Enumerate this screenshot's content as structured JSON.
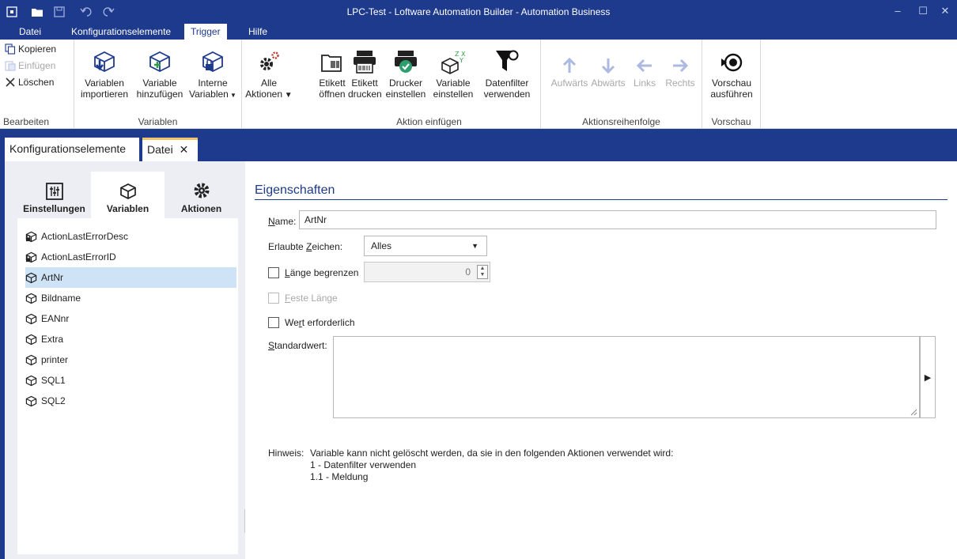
{
  "window": {
    "title": "LPC-Test - Loftware Automation Builder - Automation Business",
    "minimize": "–",
    "maximize": "☐",
    "close": "✕"
  },
  "menu": {
    "items": [
      "Datei",
      "Konfigurationselemente",
      "Trigger",
      "Hilfe"
    ],
    "active": "Trigger"
  },
  "ribbon": {
    "bearbeiten": {
      "label": "Bearbeiten",
      "kopieren": "Kopieren",
      "einfuegen": "Einfügen",
      "loeschen": "Löschen"
    },
    "variablen": {
      "label": "Variablen",
      "importieren": [
        "Variablen",
        "importieren"
      ],
      "hinzufuegen": [
        "Variable",
        "hinzufügen"
      ],
      "interne": [
        "Interne",
        "Variablen"
      ]
    },
    "alle_aktionen": [
      "Alle",
      "Aktionen"
    ],
    "aktion_einfuegen": {
      "label": "Aktion einfügen",
      "etikett_oeffnen": [
        "Etikett",
        "öffnen"
      ],
      "etikett_drucken": [
        "Etikett",
        "drucken"
      ],
      "drucker_einstellen": [
        "Drucker",
        "einstellen"
      ],
      "variable_einstellen": [
        "Variable",
        "einstellen"
      ],
      "datenfilter_verwenden": [
        "Datenfilter",
        "verwenden"
      ]
    },
    "reihenfolge": {
      "label": "Aktionsreihenfolge",
      "aufwaerts": "Aufwärts",
      "abwaerts": "Abwärts",
      "links": "Links",
      "rechts": "Rechts"
    },
    "vorschau": {
      "label": "Vorschau",
      "ausfuehren": [
        "Vorschau",
        "ausführen"
      ]
    }
  },
  "doc_tabs": {
    "tab1": "Konfigurationselemente",
    "tab2": "Datei",
    "close": "✕"
  },
  "left_panel": {
    "tabs": [
      "Einstellungen",
      "Variablen",
      "Aktionen"
    ],
    "active_tab": "Variablen",
    "variables": [
      "ActionLastErrorDesc",
      "ActionLastErrorID",
      "ArtNr",
      "Bildname",
      "EANnr",
      "Extra",
      "printer",
      "SQL1",
      "SQL2"
    ],
    "selected": "ArtNr"
  },
  "properties": {
    "title": "Eigenschaften",
    "name_label_u": "N",
    "name_label_rest": "ame:",
    "name_value": "ArtNr",
    "chars_label_pre": "Erlaubte ",
    "chars_label_u": "Z",
    "chars_label_post": "eichen:",
    "chars_value": "Alles",
    "limit_label_u": "L",
    "limit_label_rest": "änge begrenzen",
    "limit_value": "0",
    "fixed_label_u": "F",
    "fixed_label_rest": "este Länge",
    "required_label_pre": "We",
    "required_label_u": "r",
    "required_label_post": "t erforderlich",
    "default_label_u": "S",
    "default_label_rest": "tandardwert:",
    "hint_label": "Hinweis:",
    "hint_text": "Variable kann nicht gelöscht werden, da sie in den folgenden Aktionen verwendet wird:",
    "hint_line1": "1 - Datenfilter verwenden",
    "hint_line2": "1.1 - Meldung"
  },
  "colors": {
    "brand": "#1e3a8c",
    "accent_tab": "#f2c36b",
    "selection": "#cfe3f7"
  }
}
